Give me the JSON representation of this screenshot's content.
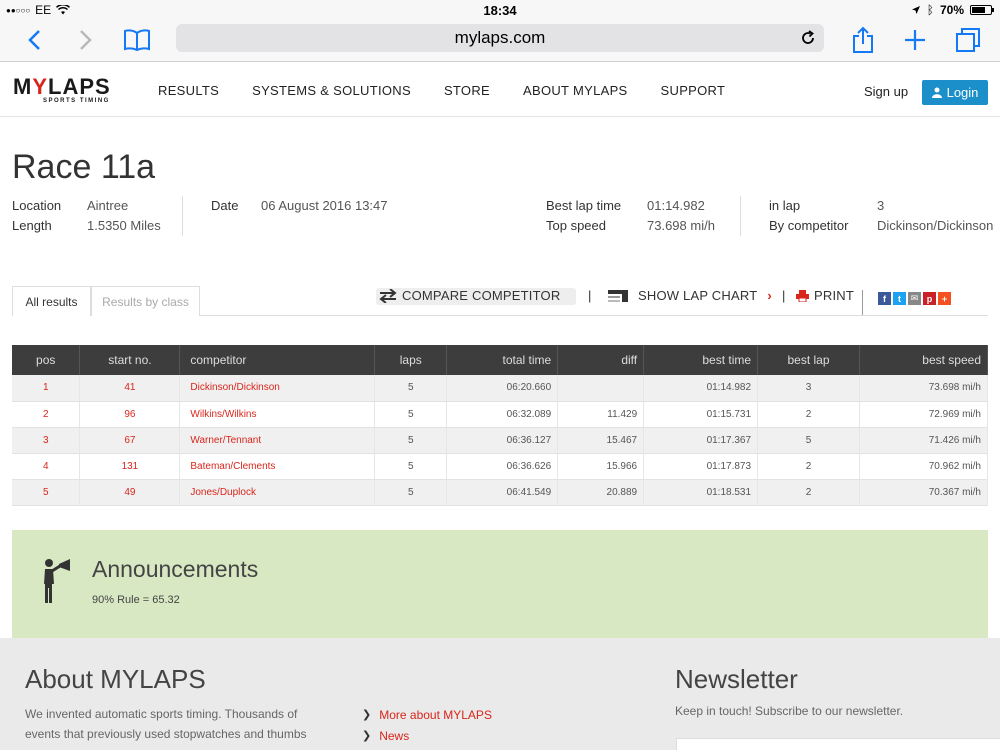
{
  "status": {
    "carrier": "EE",
    "time": "18:34",
    "battery": "70%",
    "battery_level": 0.7
  },
  "browser": {
    "url": "mylaps.com"
  },
  "nav": {
    "items": [
      "RESULTS",
      "SYSTEMS & SOLUTIONS",
      "STORE",
      "ABOUT MYLAPS",
      "SUPPORT"
    ],
    "signup": "Sign up",
    "login": "Login",
    "logo_word_1": "M",
    "logo_word_a": "Y",
    "logo_word_2": "LAPS",
    "logo_sub": "SPORTS TIMING"
  },
  "race": {
    "title": "Race 11a",
    "location_label": "Location",
    "location": "Aintree",
    "length_label": "Length",
    "length": "1.5350 Miles",
    "date_label": "Date",
    "date": "06 August 2016 13:47",
    "best_lap_label": "Best lap time",
    "best_lap": "01:14.982",
    "top_speed_label": "Top speed",
    "top_speed": "73.698 mi/h",
    "in_lap_label": "in lap",
    "in_lap": "3",
    "by_comp_label": "By competitor",
    "by_comp": "Dickinson/Dickinson"
  },
  "tabs": {
    "all": "All results",
    "by_class": "Results by class"
  },
  "actions": {
    "compare": "COMPARE COMPETITOR",
    "lap_chart": "SHOW LAP CHART",
    "print": "PRINT"
  },
  "table": {
    "headers": [
      "pos",
      "start no.",
      "competitor",
      "laps",
      "total time",
      "diff",
      "best time",
      "best lap",
      "best speed"
    ],
    "rows": [
      {
        "pos": "1",
        "start": "41",
        "competitor": "Dickinson/Dickinson",
        "laps": "5",
        "total": "06:20.660",
        "diff": "",
        "best_time": "01:14.982",
        "best_lap": "3",
        "best_speed": "73.698 mi/h"
      },
      {
        "pos": "2",
        "start": "96",
        "competitor": "Wilkins/Wilkins",
        "laps": "5",
        "total": "06:32.089",
        "diff": "11.429",
        "best_time": "01:15.731",
        "best_lap": "2",
        "best_speed": "72.969 mi/h"
      },
      {
        "pos": "3",
        "start": "67",
        "competitor": "Warner/Tennant",
        "laps": "5",
        "total": "06:36.127",
        "diff": "15.467",
        "best_time": "01:17.367",
        "best_lap": "5",
        "best_speed": "71.426 mi/h"
      },
      {
        "pos": "4",
        "start": "131",
        "competitor": "Bateman/Clements",
        "laps": "5",
        "total": "06:36.626",
        "diff": "15.966",
        "best_time": "01:17.873",
        "best_lap": "2",
        "best_speed": "70.962 mi/h"
      },
      {
        "pos": "5",
        "start": "49",
        "competitor": "Jones/Duplock",
        "laps": "5",
        "total": "06:41.549",
        "diff": "20.889",
        "best_time": "01:18.531",
        "best_lap": "2",
        "best_speed": "70.367 mi/h"
      }
    ]
  },
  "announce": {
    "title": "Announcements",
    "text": "90% Rule = 65.32"
  },
  "footer": {
    "about_title": "About MYLAPS",
    "about_text": "We invented automatic sports timing. Thousands of events that previously used stopwatches and thumbs",
    "links": [
      "More about MYLAPS",
      "News"
    ],
    "nl_title": "Newsletter",
    "nl_text": "Keep in touch! Subscribe to our newsletter."
  },
  "colors": {
    "accent_red": "#d9261c",
    "login_blue": "#1a8fc9",
    "ios_blue": "#1479f6",
    "announce_green": "#d7e8c3"
  }
}
